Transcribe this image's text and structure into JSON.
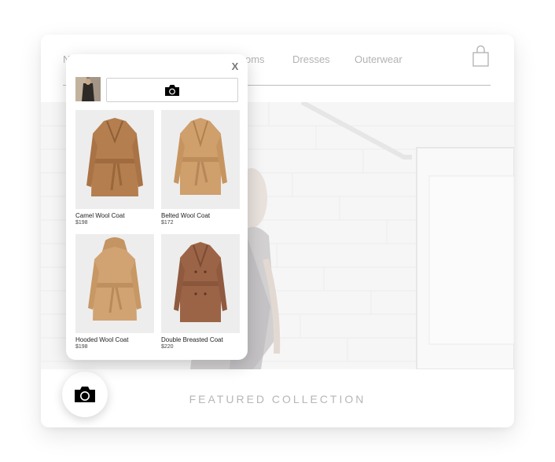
{
  "nav": {
    "items": [
      {
        "label": "N"
      },
      {
        "label": "oms"
      },
      {
        "label": "Dresses"
      },
      {
        "label": "Outerwear"
      }
    ],
    "cart_icon": "shopping-bag-icon"
  },
  "hero": {
    "image": "model-in-front-of-white-brick-wall"
  },
  "featured": {
    "title": "FEATURED COLLECTION"
  },
  "camera_button": {
    "icon": "camera-icon"
  },
  "popup": {
    "close_label": "X",
    "search_icon": "camera-icon",
    "products": [
      {
        "name": "Camel Wool Coat",
        "price": "$198",
        "color": "#b47e4e"
      },
      {
        "name": "Belted Wool Coat",
        "price": "$172",
        "color": "#cf9f6c"
      },
      {
        "name": "Hooded Wool Coat",
        "price": "$198",
        "color": "#d1a373"
      },
      {
        "name": "Double Breasted Coat",
        "price": "$220",
        "color": "#9c6446"
      }
    ]
  },
  "colors": {
    "nav_text": "#b3b3b3",
    "featured_text": "#b6b6b6"
  }
}
